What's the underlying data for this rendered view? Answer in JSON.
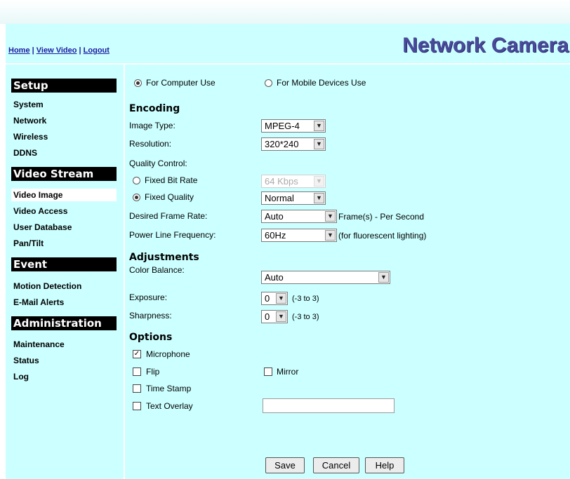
{
  "header": {
    "links": [
      "Home",
      "View Video",
      "Logout"
    ],
    "separator": "|",
    "brand": "Network Camera"
  },
  "sidebar": {
    "sections": [
      {
        "title": "Setup",
        "items": [
          "System",
          "Network",
          "Wireless",
          "DDNS"
        ]
      },
      {
        "title": "Video Stream",
        "items": [
          "Video Image",
          "Video Access",
          "User Database",
          "Pan/Tilt"
        ]
      },
      {
        "title": "Event",
        "items": [
          "Motion Detection",
          "E-Mail Alerts"
        ]
      },
      {
        "title": "Administration",
        "items": [
          "Maintenance",
          "Status",
          "Log"
        ]
      }
    ],
    "active_item": "Video Image"
  },
  "mode": {
    "computer_label": "For Computer Use",
    "mobile_label": "For Mobile Devices Use",
    "selected": "computer"
  },
  "encoding": {
    "title": "Encoding",
    "image_type_label": "Image Type:",
    "image_type_value": "MPEG-4",
    "resolution_label": "Resolution:",
    "resolution_value": "320*240",
    "quality_control_label": "Quality Control:",
    "fixed_bit_rate_label": "Fixed Bit Rate",
    "fixed_bit_rate_value": "64 Kbps",
    "fixed_quality_label": "Fixed Quality",
    "fixed_quality_value": "Normal",
    "quality_selected": "fixed_quality",
    "frame_rate_label": "Desired Frame Rate:",
    "frame_rate_value": "Auto",
    "frame_rate_unit": "Frame(s) - Per Second",
    "power_line_label": "Power Line Frequency:",
    "power_line_value": "60Hz",
    "power_line_hint": "(for fluorescent lighting)"
  },
  "adjustments": {
    "title": "Adjustments",
    "color_balance_label": "Color Balance:",
    "color_balance_value": "Auto",
    "exposure_label": "Exposure:",
    "exposure_value": "0",
    "exposure_range": "(-3 to 3)",
    "sharpness_label": "Sharpness:",
    "sharpness_value": "0",
    "sharpness_range": "(-3 to 3)"
  },
  "options": {
    "title": "Options",
    "microphone_label": "Microphone",
    "microphone_checked": true,
    "flip_label": "Flip",
    "flip_checked": false,
    "mirror_label": "Mirror",
    "mirror_checked": false,
    "time_stamp_label": "Time Stamp",
    "time_stamp_checked": false,
    "text_overlay_label": "Text Overlay",
    "text_overlay_checked": false,
    "text_overlay_value": ""
  },
  "buttons": {
    "save": "Save",
    "cancel": "Cancel",
    "help": "Help"
  },
  "colors": {
    "panel_bg": "#ccffff",
    "link": "#1a1aa0",
    "brand": "#4a4a9a"
  }
}
